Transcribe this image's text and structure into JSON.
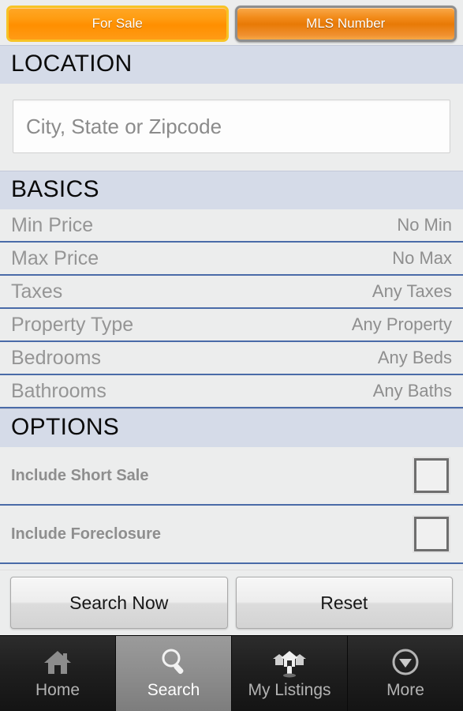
{
  "toggle": {
    "options": [
      {
        "label": "For Sale",
        "selected": true,
        "name": "for-sale-toggle"
      },
      {
        "label": "MLS Number",
        "selected": false,
        "name": "mls-number-toggle"
      }
    ]
  },
  "location": {
    "header": "LOCATION",
    "placeholder": "City, State or Zipcode",
    "value": ""
  },
  "basics": {
    "header": "BASICS",
    "rows": [
      {
        "label": "Min Price",
        "value": "No Min"
      },
      {
        "label": "Max Price",
        "value": "No Max"
      },
      {
        "label": "Taxes",
        "value": "Any Taxes"
      },
      {
        "label": "Property Type",
        "value": "Any Property"
      },
      {
        "label": "Bedrooms",
        "value": "Any Beds"
      },
      {
        "label": "Bathrooms",
        "value": "Any Baths"
      }
    ]
  },
  "options": {
    "header": "OPTIONS",
    "rows": [
      {
        "label": "Include Short Sale",
        "checked": false
      },
      {
        "label": "Include Foreclosure",
        "checked": false
      }
    ]
  },
  "actions": {
    "search_label": "Search Now",
    "reset_label": "Reset"
  },
  "tabbar": {
    "tabs": [
      {
        "label": "Home",
        "icon": "home-icon",
        "active": false
      },
      {
        "label": "Search",
        "icon": "search-icon",
        "active": true
      },
      {
        "label": "My Listings",
        "icon": "houses-pin-icon",
        "active": false
      },
      {
        "label": "More",
        "icon": "chevron-down-circle-icon",
        "active": false
      }
    ]
  },
  "colors": {
    "accent_orange": "#ff8f00",
    "selected_border": "#f7c325",
    "section_header_bg": "#d5dbe8",
    "row_separator": "#4a6ba8",
    "page_bg": "#eceded",
    "tab_active_bg": "#8d8d8d"
  }
}
